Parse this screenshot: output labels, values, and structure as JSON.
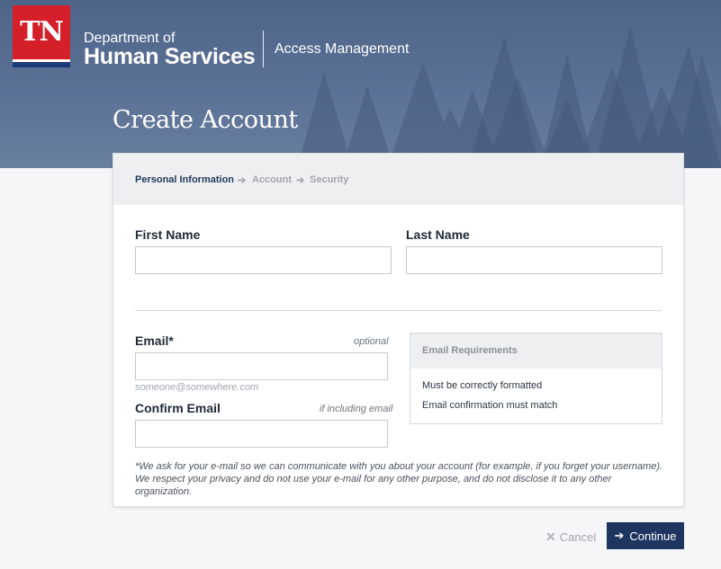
{
  "header": {
    "logo_text": "TN",
    "dept_line1": "Department of",
    "dept_line2": "Human Services",
    "app_name": "Access Management",
    "page_title": "Create Account"
  },
  "steps": [
    {
      "label": "Personal Information",
      "state": "active"
    },
    {
      "label": "Account",
      "state": "inactive"
    },
    {
      "label": "Security",
      "state": "inactive"
    }
  ],
  "form": {
    "first_name": {
      "label": "First Name",
      "value": ""
    },
    "last_name": {
      "label": "Last Name",
      "value": ""
    },
    "email": {
      "label": "Email*",
      "hint": "optional",
      "value": "",
      "note": "someone@somewhere.com"
    },
    "confirm_email": {
      "label": "Confirm Email",
      "hint": "if including email",
      "value": ""
    }
  },
  "requirements": {
    "title": "Email Requirements",
    "items": [
      "Must be correctly formatted",
      "Email confirmation must match"
    ]
  },
  "footnote": "*We ask for your e-mail so we can communicate with you about your account (for example, if you forget your username). We respect your privacy and do not use your e-mail for any other purpose, and do not disclose it to any other organization.",
  "actions": {
    "cancel": "Cancel",
    "continue": "Continue"
  },
  "icons": {
    "step_arrow": "arrow-right-icon",
    "cancel": "close-icon",
    "continue": "arrow-right-icon"
  },
  "colors": {
    "brand_red": "#d5202a",
    "brand_navy": "#1e3560",
    "hero_blue": "#5b7196"
  }
}
